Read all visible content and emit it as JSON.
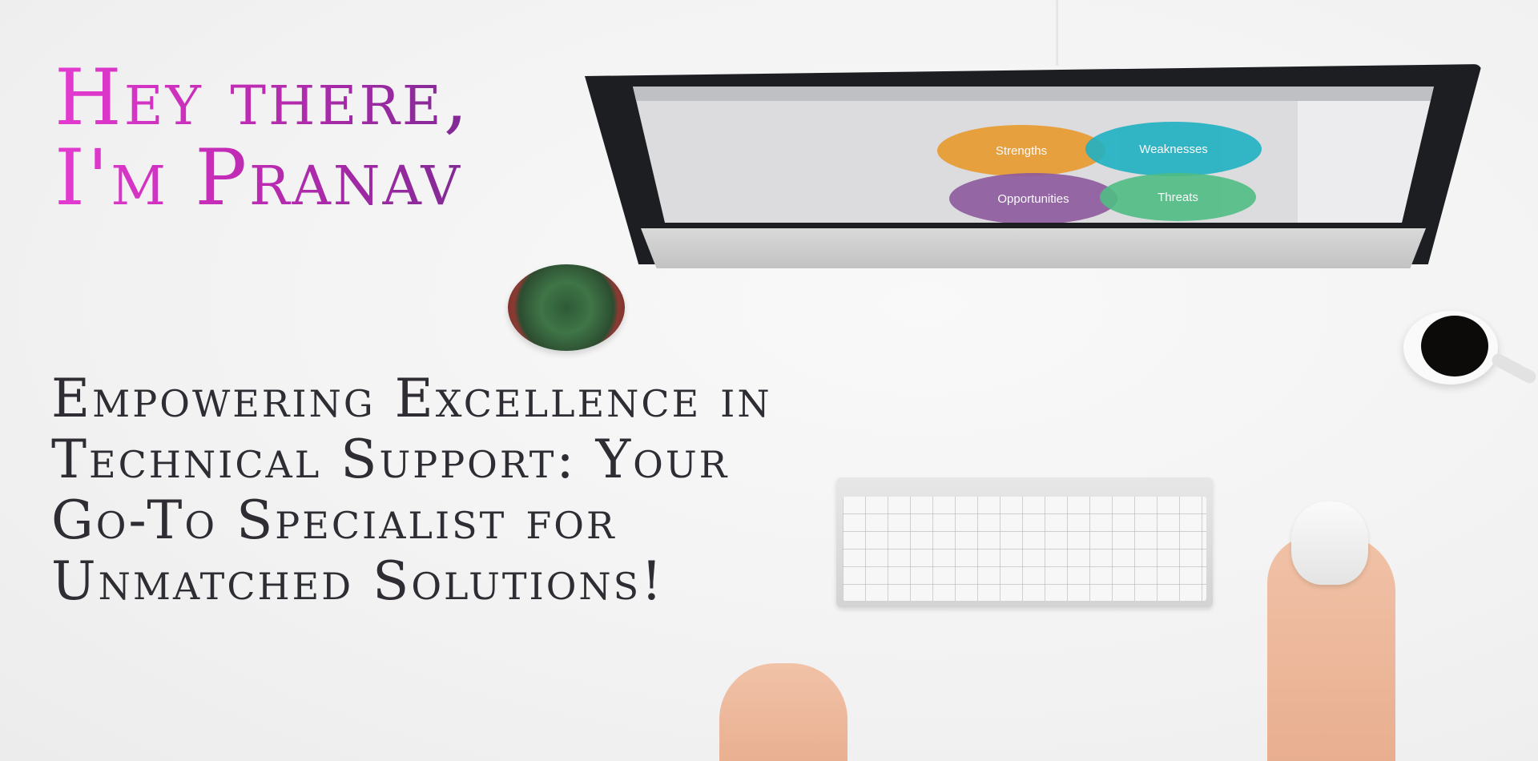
{
  "hero": {
    "greeting_line1": "Hey there,",
    "greeting_line2": "I'm Pranav",
    "tagline": "Empowering Excellence in Technical Support: Your Go-To Specialist for Unmatched Solutions!"
  },
  "screen_diagram": {
    "strengths": "Strengths",
    "weaknesses": "Weaknesses",
    "opportunities": "Opportunities",
    "threats": "Threats"
  },
  "colors": {
    "greeting_gradient_start": "#e43bd0",
    "greeting_gradient_end": "#7f2a93",
    "tagline_color": "#2f2c33",
    "strengths": "#e89a2c",
    "weaknesses": "#1fb0c2",
    "opportunities": "#8d5a9e",
    "threats": "#4fbc84"
  }
}
